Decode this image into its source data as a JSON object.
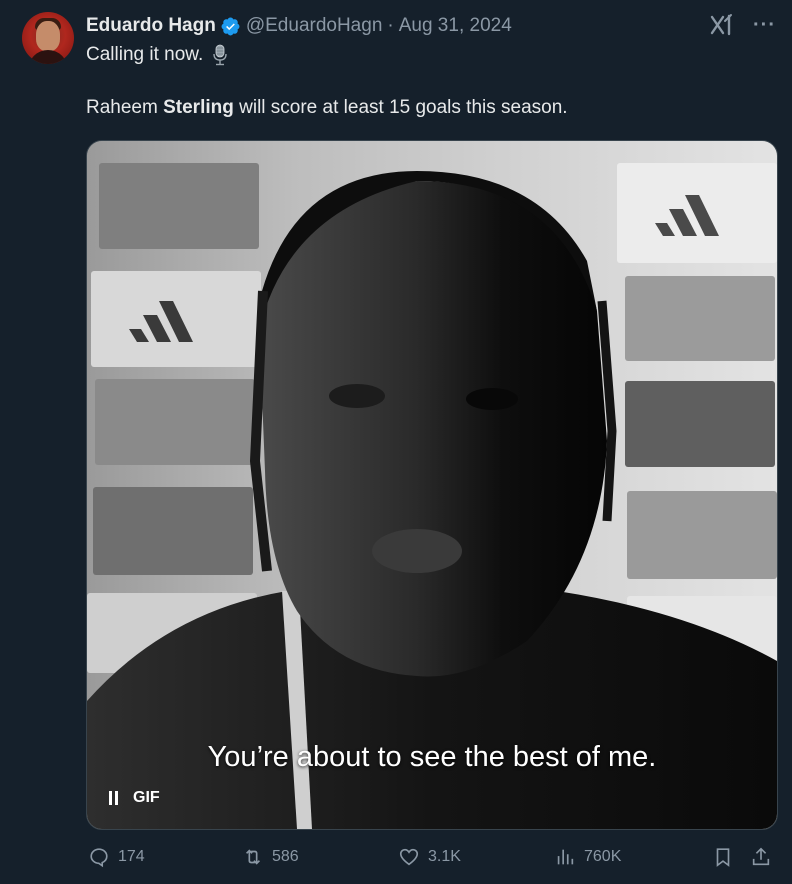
{
  "tweet": {
    "author_name": "Eduardo Hagn",
    "handle": "@EduardoHagn",
    "separator": "·",
    "date": "Aug 31, 2024",
    "line1": "Calling it now.",
    "line2_prefix": "Raheem ",
    "line2_bold": "Sterling",
    "line2_suffix": " will score at least 15 goals this season."
  },
  "media": {
    "caption": "You’re about to see the best of me.",
    "badge": "GIF"
  },
  "actions": {
    "replies": "174",
    "reposts": "586",
    "likes": "3.1K",
    "views": "760K"
  },
  "colors": {
    "background": "#15202b",
    "verified": "#1d9bf0",
    "muted": "#8b98a5"
  }
}
